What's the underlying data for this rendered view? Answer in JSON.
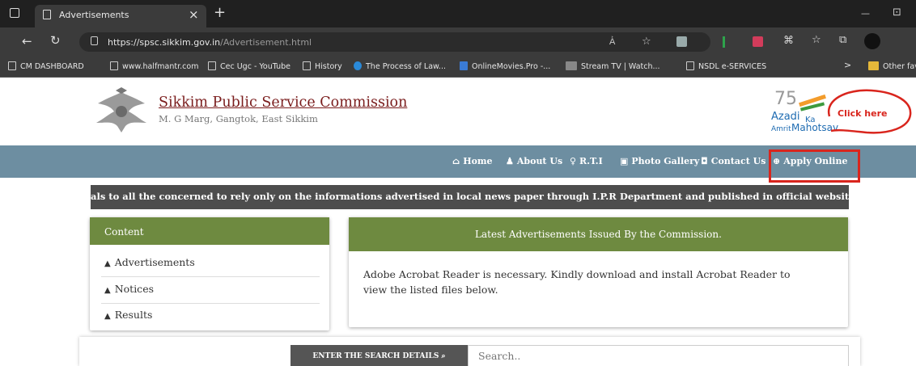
{
  "tab": {
    "title": "Advertisements",
    "close": "×",
    "new_tab": "+"
  },
  "window": {
    "minimize": "—",
    "restore": "⊡"
  },
  "address": {
    "url_host": "https://spsc.sikkim.gov.in",
    "url_path": "/Advertisement.html"
  },
  "bookmarks": [
    {
      "label": "CM DASHBOARD"
    },
    {
      "label": "www.halfmantr.com"
    },
    {
      "label": "Cec Ugc - YouTube"
    },
    {
      "label": "History"
    },
    {
      "label": "The Process of Law..."
    },
    {
      "label": "OnlineMovies.Pro -..."
    },
    {
      "label": "Stream TV | Watch..."
    },
    {
      "label": "NSDL e-SERVICES"
    }
  ],
  "bookmarks_more": ">",
  "other_favorites": "Other favo",
  "site": {
    "title": "Sikkim Public Service Commission",
    "address": "M. G Marg, Gangtok, East Sikkim",
    "azadi_75": "75",
    "azadi_line1": "Azadi",
    "azadi_ka": "Ka",
    "azadi_line2": "Amrit",
    "azadi_mahotsav": "Mahotsav"
  },
  "annotation": {
    "text": "Click here",
    "color": "#d9251d"
  },
  "nav": [
    {
      "label": "Home",
      "icon": "home-icon"
    },
    {
      "label": "About Us",
      "icon": "users-icon"
    },
    {
      "label": "R.T.I",
      "icon": "award-icon"
    },
    {
      "label": "Photo Gallery",
      "icon": "image-icon"
    },
    {
      "label": "Contact Us",
      "icon": "contact-icon"
    },
    {
      "label": "Apply Online",
      "icon": "globe-icon"
    }
  ],
  "ticker": "als to all the concerned to rely only on the informations advertised in local news paper through I.P.R Department and published in official website of S.P.S.C",
  "content": {
    "heading": "Content",
    "items": [
      {
        "label": "Advertisements"
      },
      {
        "label": "Notices"
      },
      {
        "label": "Results"
      }
    ]
  },
  "latest": {
    "heading": "Latest Advertisements Issued By the Commission.",
    "body": "Adobe Acrobat Reader is necessary. Kindly download and install Acrobat Reader to view the listed files below."
  },
  "search": {
    "button_label": "ENTER THE SEARCH DETAILS",
    "placeholder": "Search.."
  },
  "colors": {
    "nav_bg": "#6d8ea1",
    "panel_head": "#6e8a40",
    "title": "#7a1c1c",
    "ticker_bg": "#4d4d4d"
  }
}
